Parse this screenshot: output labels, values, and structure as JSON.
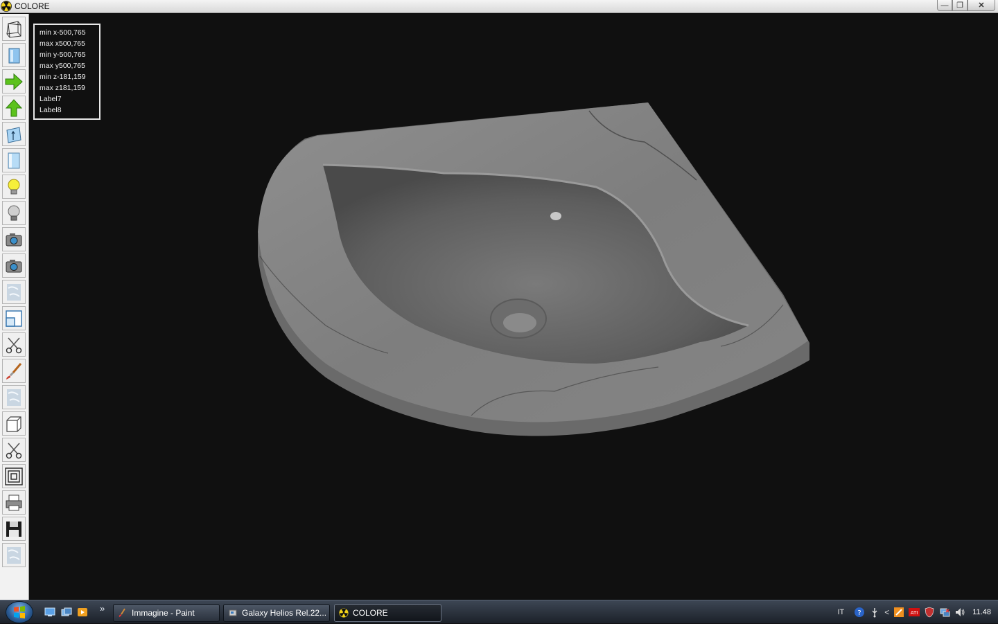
{
  "window": {
    "title": "COLORE"
  },
  "toolbar": {
    "tools": [
      {
        "name": "wireframe-tool",
        "icon": "wireframe-cube-icon"
      },
      {
        "name": "solid-view-tool",
        "icon": "solid-panel-icon"
      },
      {
        "name": "move-right-tool",
        "icon": "green-arrow-right-icon"
      },
      {
        "name": "move-up-tool",
        "icon": "green-arrow-up-icon"
      },
      {
        "name": "extrude-tool",
        "icon": "extrude-panel-icon"
      },
      {
        "name": "panel-tool",
        "icon": "glass-panel-icon"
      },
      {
        "name": "light-on-tool",
        "icon": "lightbulb-on-icon"
      },
      {
        "name": "light-off-tool",
        "icon": "lightbulb-off-icon"
      },
      {
        "name": "camera-tool",
        "icon": "camera-icon"
      },
      {
        "name": "camera-alt-tool",
        "icon": "camera-icon"
      },
      {
        "name": "texture-tool",
        "icon": "marble-texture-icon"
      },
      {
        "name": "window-tool",
        "icon": "window-layout-icon"
      },
      {
        "name": "cut-tool",
        "icon": "scissors-icon"
      },
      {
        "name": "paint-tool",
        "icon": "paintbrush-icon"
      },
      {
        "name": "texture-alt-tool",
        "icon": "marble-texture-icon"
      },
      {
        "name": "box-tool",
        "icon": "box-icon"
      },
      {
        "name": "cut-alt-tool",
        "icon": "scissors-icon"
      },
      {
        "name": "offset-tool",
        "icon": "concentric-squares-icon"
      },
      {
        "name": "print-tool",
        "icon": "printer-icon"
      },
      {
        "name": "save-tool",
        "icon": "floppy-disk-icon"
      },
      {
        "name": "texture-3-tool",
        "icon": "marble-texture-icon"
      }
    ]
  },
  "info": {
    "lines": [
      "min x-500,765",
      "max x500,765",
      "min y-500,765",
      "max y500,765",
      "min z-181,159",
      "max z181,159",
      "Label7",
      "Label8"
    ]
  },
  "taskbar": {
    "more": "»",
    "tasks": [
      {
        "label": "Immagine - Paint",
        "icon": "paint-app-icon"
      },
      {
        "label": "Galaxy Helios  Rel.22...",
        "icon": "galaxy-app-icon"
      },
      {
        "label": "COLORE",
        "icon": "radiation-app-icon"
      }
    ],
    "lang": "IT",
    "clock": "11.48"
  },
  "colors": {
    "background": "#101010",
    "marble": "#7c7c7c",
    "toolbar": "#f2f2f2"
  }
}
